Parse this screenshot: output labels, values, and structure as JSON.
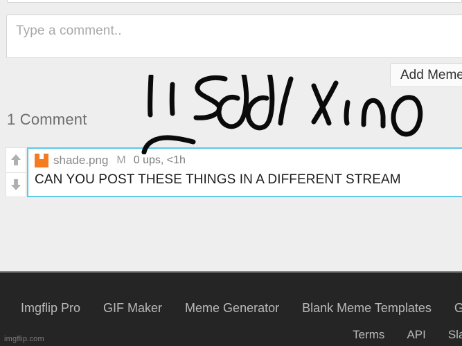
{
  "composer": {
    "placeholder": "Type a comment..",
    "value": ""
  },
  "toolbar": {
    "add_meme_label": "Add Meme"
  },
  "comments_section": {
    "heading": "1 Comment",
    "count": 1,
    "items": [
      {
        "avatar_icon": "imgflip-avatar-icon",
        "username": "shade.png",
        "mod_badge": "M",
        "meta": "0 ups, <1h",
        "ups": 0,
        "age": "<1h",
        "text": "CAN YOU POST THESE THINGS IN A DIFFERENT STREAM",
        "upvote_icon": "arrow-up-icon",
        "downvote_icon": "arrow-down-icon",
        "highlight_color": "#5bc8e8",
        "avatar_color": "#f47b20"
      }
    ]
  },
  "annotation": {
    "name": "handwritten-scribble",
    "text": "lisddlxino",
    "color": "#0a0a0a"
  },
  "footer": {
    "links": [
      "Imgflip Pro",
      "GIF Maker",
      "Meme Generator",
      "Blank Meme Templates",
      "GIF Te"
    ],
    "sub_links": [
      "Terms",
      "API",
      "Slack Ap"
    ],
    "watermark": "imgflip.com",
    "background_color": "#252525"
  }
}
